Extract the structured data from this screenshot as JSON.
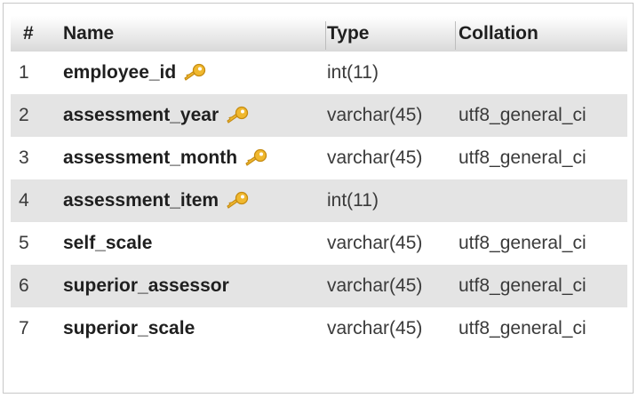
{
  "table": {
    "columns": {
      "num": "#",
      "name": "Name",
      "type": "Type",
      "collation": "Collation"
    },
    "rows": [
      {
        "num": "1",
        "name": "employee_id",
        "type": "int(11)",
        "collation": "",
        "primary_key": true,
        "icon": "key-icon"
      },
      {
        "num": "2",
        "name": "assessment_year",
        "type": "varchar(45)",
        "collation": "utf8_general_ci",
        "primary_key": true,
        "icon": "key-icon"
      },
      {
        "num": "3",
        "name": "assessment_month",
        "type": "varchar(45)",
        "collation": "utf8_general_ci",
        "primary_key": true,
        "icon": "key-icon"
      },
      {
        "num": "4",
        "name": "assessment_item",
        "type": "int(11)",
        "collation": "",
        "primary_key": true,
        "icon": "key-icon"
      },
      {
        "num": "5",
        "name": "self_scale",
        "type": "varchar(45)",
        "collation": "utf8_general_ci",
        "primary_key": false
      },
      {
        "num": "6",
        "name": "superior_assessor",
        "type": "varchar(45)",
        "collation": "utf8_general_ci",
        "primary_key": false
      },
      {
        "num": "7",
        "name": "superior_scale",
        "type": "varchar(45)",
        "collation": "utf8_general_ci",
        "primary_key": false
      }
    ]
  },
  "colors": {
    "row_alt": "#e4e4e4",
    "key_icon": "#f0b82e"
  }
}
